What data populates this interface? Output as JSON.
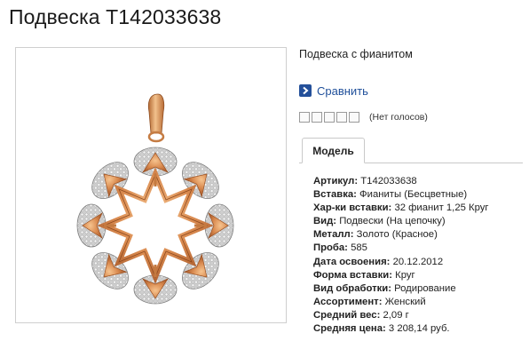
{
  "product": {
    "title": "Подвеска Т142033638",
    "subtitle": "Подвеска с фианитом",
    "image_alt": "pendant-image"
  },
  "actions": {
    "compare_label": "Сравнить",
    "compare_icon": "chevron-right-icon"
  },
  "rating": {
    "stars_total": 5,
    "stars_filled": 0,
    "votes_text": "(Нет голосов)"
  },
  "tabs": [
    {
      "label": "Модель",
      "active": true
    }
  ],
  "specs": [
    {
      "label": "Артикул:",
      "value": "Т142033638"
    },
    {
      "label": "Вставка:",
      "value": "Фианиты (Бесцветные)"
    },
    {
      "label": "Хар-ки вставки:",
      "value": "32 фианит 1,25 Круг"
    },
    {
      "label": "Вид:",
      "value": "Подвески (На цепочку)"
    },
    {
      "label": "Металл:",
      "value": "Золото (Красное)"
    },
    {
      "label": "Проба:",
      "value": "585"
    },
    {
      "label": "Дата освоения:",
      "value": "20.12.2012"
    },
    {
      "label": "Форма вставки:",
      "value": "Круг"
    },
    {
      "label": "Вид обработки:",
      "value": "Родирование"
    },
    {
      "label": "Ассортимент:",
      "value": "Женский"
    },
    {
      "label": "Средний вес:",
      "value": "2,09 г"
    },
    {
      "label": "Средняя цена:",
      "value": "3 208,14 руб."
    }
  ],
  "colors": {
    "link": "#1f4f9a",
    "compare_icon_bg": "#24509a",
    "gold": "#d98a4f",
    "silver": "#b8b8b8"
  }
}
